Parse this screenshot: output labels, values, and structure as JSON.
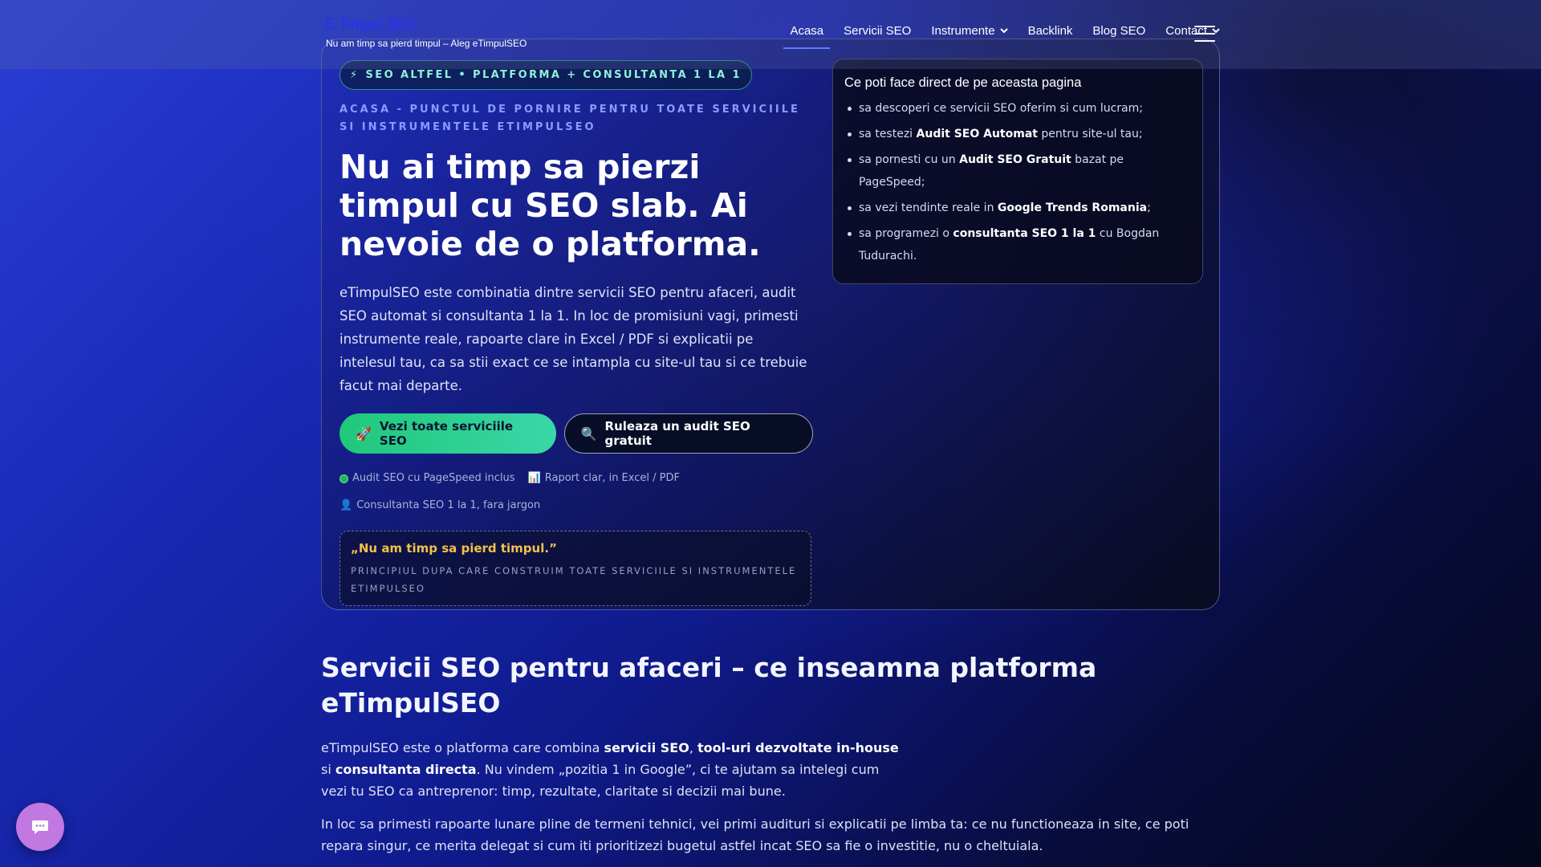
{
  "header": {
    "brand_name": "E Timpul SEO",
    "brand_tagline": "Nu am timp sa pierd timpul – Aleg eTimpulSEO",
    "nav": [
      {
        "label": "Acasa"
      },
      {
        "label": "Servicii SEO"
      },
      {
        "label": "Instrumente"
      },
      {
        "label": "Backlink"
      },
      {
        "label": "Blog SEO"
      },
      {
        "label": "Contact"
      }
    ]
  },
  "hero": {
    "pill_icon": "⚡",
    "pill_text": "SEO ALTFEL • PLATFORMA + CONSULTANTA 1 LA 1",
    "eyebrow": "ACASA - PUNCTUL DE PORNIRE PENTRU TOATE SERVICIILE SI INSTRUMENTELE ETIMPULSEO",
    "title": "Nu ai timp sa pierzi timpul cu SEO slab. Ai nevoie de o platforma.",
    "text": "eTimpulSEO este combinatia dintre servicii SEO pentru afaceri, audit SEO automat si consultanta 1 la 1. In loc de promisiuni vagi, primesti instrumente reale, rapoarte clare in Excel / PDF si explicatii pe intelesul tau, ca sa stii exact ce se intampla cu site-ul tau si ce trebuie facut mai departe.",
    "primary_button": {
      "icon": "🚀",
      "label": "Vezi toate serviciile SEO"
    },
    "secondary_button": {
      "icon": "🔍",
      "label": "Ruleaza un audit SEO gratuit"
    },
    "features": [
      {
        "icon": "",
        "label": "Audit SEO cu PageSpeed inclus"
      },
      {
        "icon": "📊",
        "label": "Raport clar, in Excel / PDF"
      },
      {
        "icon": "👤",
        "label": "Consultanta SEO 1 la 1, fara jargon"
      }
    ],
    "quote": "„Nu am timp sa pierd timpul.”",
    "quote_sub": "PRINCIPIUL DUPA CARE CONSTRUIM TOATE SERVICIILE SI INSTRUMENTELE ETIMPULSEO"
  },
  "side_panel": {
    "title": "Ce poti face direct de pe aceasta pagina",
    "items": [
      {
        "pre": "sa descoperi ce servicii SEO oferim si cum lucram;",
        "bold": "",
        "post": ""
      },
      {
        "pre": "sa testezi ",
        "bold": "Audit SEO Automat",
        "post": " pentru site-ul tau;"
      },
      {
        "pre": "sa pornesti cu un ",
        "bold": "Audit SEO Gratuit",
        "post": " bazat pe PageSpeed;"
      },
      {
        "pre": "sa vezi tendinte reale in ",
        "bold": "Google Trends Romania",
        "post": ";"
      },
      {
        "pre": "sa programezi o ",
        "bold": "consultanta SEO 1 la 1",
        "post": " cu Bogdan Tudurachi."
      }
    ]
  },
  "section": {
    "title": "Servicii SEO pentru afaceri – ce inseamna platforma eTimpulSEO",
    "p1": {
      "t1": "eTimpulSEO este o platforma care combina ",
      "b1": "servicii SEO",
      "t2": ", ",
      "b2": "tool-uri dezvoltate in-house",
      "t3": " si ",
      "b3": "consultanta directa",
      "t4": ". Nu vindem „pozitia 1 in Google”, ci te ajutam sa intelegi cum vezi tu SEO ca antreprenor: timp, rezultate, claritate si decizii mai bune."
    },
    "p2": "In loc sa primesti rapoarte lunare pline de termeni tehnici, vei primi audituri si explicatii pe limba ta: ce nu functioneaza in site, ce poti repara singur, ce merita delegat si cum iti prioritizezi bugetul astfel incat SEO sa fie o investitie, nu o cheltuiala."
  },
  "colors": {
    "accent": "#5b7cff",
    "cta_green": "#1fc87a",
    "quote_gold": "#f3c14a",
    "chat_purple": "#c178e0"
  },
  "icons": {
    "chat": "chat-bubble-icon",
    "menu": "hamburger-menu-icon",
    "dropdown": "chevron-down-icon"
  }
}
